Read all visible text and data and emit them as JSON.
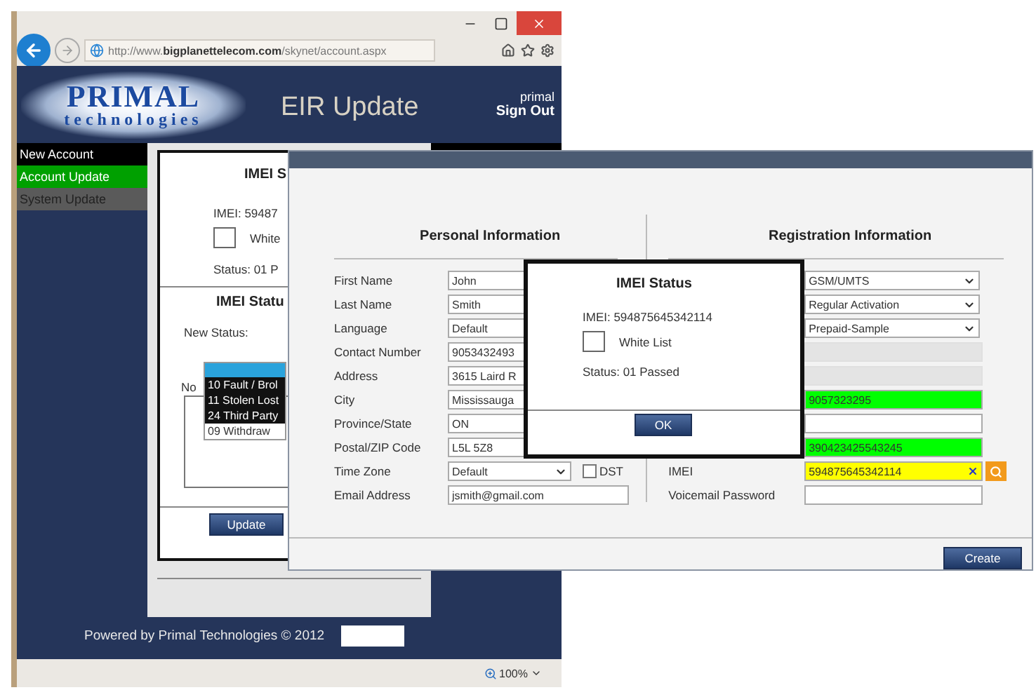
{
  "browser": {
    "address": "http://www.**bigplanettelecom.com**/skynet/account.aspx",
    "zoom": "100%"
  },
  "header": {
    "logo_top": "PRIMAL",
    "logo_bottom": "technologies",
    "title": "EIR Update",
    "user": "primal",
    "sign_out": "Sign Out"
  },
  "sidebar": {
    "items": [
      {
        "label": "New Account",
        "selected": false,
        "disabled": false
      },
      {
        "label": "Account Update",
        "selected": true,
        "disabled": false
      },
      {
        "label": "System Update",
        "selected": false,
        "disabled": true
      }
    ]
  },
  "background_dialog": {
    "title": "IMEI S",
    "imei": "IMEI: 59487",
    "whitelist": {
      "label": "White",
      "checked": false
    },
    "status": "Status: 01 P",
    "section_title": "IMEI Statu",
    "new_status_label": "New Status:",
    "status_options": [
      {
        "label": "10 Fault / Brol",
        "selected": true
      },
      {
        "label": "11 Stolen Lost",
        "selected": true
      },
      {
        "label": "24 Third Party",
        "selected": true
      },
      {
        "label": "09 Withdraw",
        "selected": false
      }
    ],
    "notes_label": "No",
    "button": "Update"
  },
  "footer": "Powered by Primal Technologies © 2012",
  "account_window": {
    "personal": {
      "heading": "Personal Information",
      "rows": [
        {
          "kind": "input",
          "label": "First Name",
          "value": "John"
        },
        {
          "kind": "input",
          "label": "Last Name",
          "value": "Smith"
        },
        {
          "kind": "input",
          "label": "Language",
          "value": "Default"
        },
        {
          "kind": "input",
          "label": "Contact Number",
          "value": "9053432493"
        },
        {
          "kind": "input",
          "label": "Address",
          "value": "3615 Laird R"
        },
        {
          "kind": "input",
          "label": "City",
          "value": "Mississauga"
        },
        {
          "kind": "input",
          "label": "Province/State",
          "value": "ON"
        },
        {
          "kind": "input",
          "label": "Postal/ZIP Code",
          "value": "L5L 5Z8"
        },
        {
          "kind": "select",
          "label": "Time Zone",
          "value": "Default",
          "checkbox": {
            "label": "DST",
            "checked": false
          }
        },
        {
          "kind": "input",
          "label": "Email Address",
          "value": "jsmith@gmail.com"
        }
      ]
    },
    "registration": {
      "heading": "Registration Information",
      "rows": [
        {
          "kind": "select",
          "value": "GSM/UMTS"
        },
        {
          "kind": "select",
          "value": "Regular Activation"
        },
        {
          "kind": "select",
          "value": "Prepaid-Sample"
        },
        {
          "kind": "disabled"
        },
        {
          "kind": "disabled"
        },
        {
          "kind": "input",
          "value": "9057323295",
          "color": "#00ff00"
        },
        {
          "kind": "input"
        },
        {
          "kind": "input",
          "value": "390423425543245",
          "color": "#00ff00"
        },
        {
          "kind": "lookup",
          "label": "IMEI",
          "value": "594875645342114",
          "color": "#ffff00"
        },
        {
          "kind": "input",
          "label": "Voicemail Password"
        }
      ]
    },
    "button": "Create"
  },
  "imei_dialog": {
    "title": "IMEI Status",
    "imei": "IMEI: 594875645342114",
    "whitelist": {
      "label": "White List",
      "checked": false
    },
    "status": "Status: 01 Passed",
    "button": "OK"
  }
}
